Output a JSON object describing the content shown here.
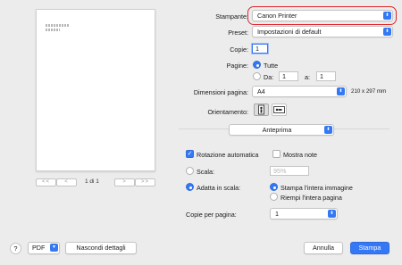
{
  "preview": {
    "page_counter": "1 di 1",
    "first_label": "<<",
    "prev_label": "<",
    "next_label": ">",
    "last_label": ">>"
  },
  "printer": {
    "label": "Stampante:",
    "value": "Canon Printer"
  },
  "preset": {
    "label": "Preset:",
    "value": "Impostazioni di default"
  },
  "copies": {
    "label": "Copie:",
    "value": "1"
  },
  "pages": {
    "label": "Pagine:",
    "all_label": "Tutte",
    "from_label": "Da:",
    "from_value": "1",
    "to_label": "a:",
    "to_value": "1"
  },
  "paper_size": {
    "label": "Dimensioni pagina:",
    "value": "A4",
    "dimensions": "210 x 297 mm"
  },
  "orientation": {
    "label": "Orientamento:"
  },
  "section": {
    "value": "Anteprima"
  },
  "options": {
    "auto_rotate_label": "Rotazione automatica",
    "show_notes_label": "Mostra note",
    "scale_label": "Scala:",
    "scale_value": "95%",
    "fit_label": "Adatta in scala:",
    "print_entire_label": "Stampa l'intera immagine",
    "fill_page_label": "Riempi l'intera pagina"
  },
  "copies_per_page": {
    "label": "Copie per pagina:",
    "value": "1"
  },
  "footer": {
    "help_label": "?",
    "pdf_label": "PDF",
    "hide_details_label": "Nascondi dettagli",
    "cancel_label": "Annulla",
    "print_label": "Stampa"
  },
  "colors": {
    "accent": "#3478f6",
    "highlight": "#e0262b"
  }
}
